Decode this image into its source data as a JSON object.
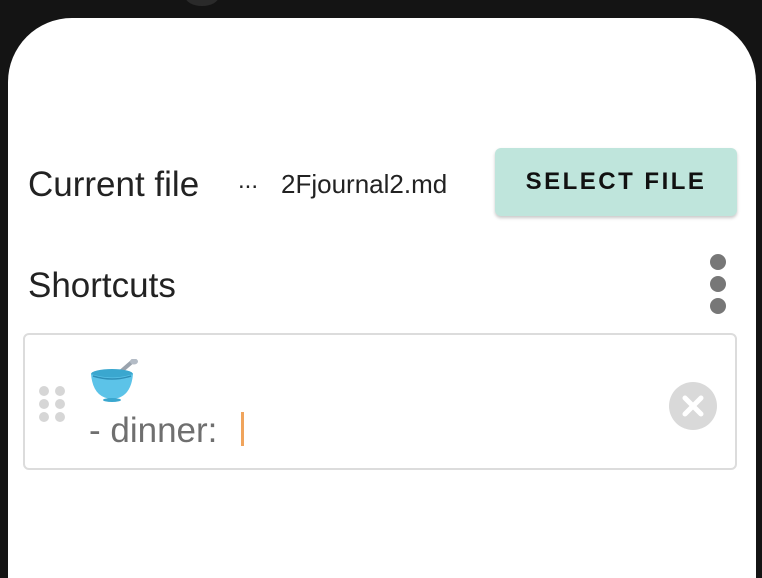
{
  "file_row": {
    "label": "Current file",
    "ellipsis": "...",
    "filename": "2Fjournal2.md",
    "select_button_label": "SELECT FILE"
  },
  "shortcuts": {
    "title": "Shortcuts",
    "menu_icon": "more-vert-icon",
    "items": [
      {
        "emoji_icon": "bowl-with-spoon-icon",
        "text": "- dinner: ",
        "drag_icon": "drag-handle-icon",
        "clear_icon": "close-circle-icon"
      }
    ]
  },
  "colors": {
    "sheet_background": "#ffffff",
    "window_background": "#141414",
    "select_button_bg": "#bfe5dc",
    "text_primary": "#222222",
    "shortcut_text": "#6f6f6f",
    "caret": "#f0a45c",
    "icon_grey": "#777777"
  }
}
